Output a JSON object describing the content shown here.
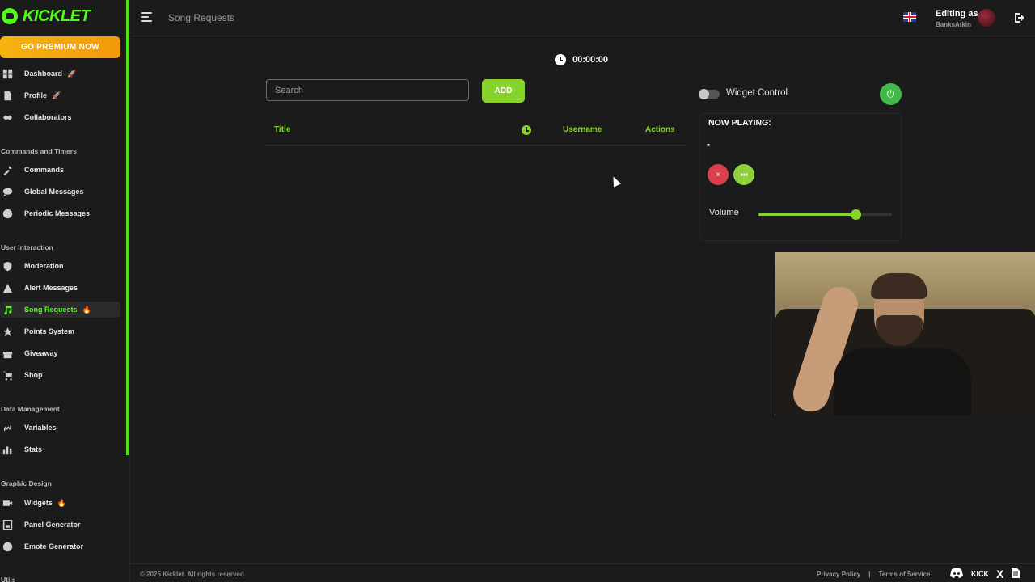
{
  "app": {
    "logo_text": "KICKLET",
    "premium_label": "GO PREMIUM NOW"
  },
  "colors": {
    "accent": "#86d42b",
    "kick_green": "#53fc18",
    "premium": "#f6b40e",
    "stop": "#d9404c",
    "power": "#43b94a"
  },
  "sidebar": {
    "items": [
      {
        "label": "Dashboard",
        "icon": "grid-icon",
        "badge": "🚀"
      },
      {
        "label": "Profile",
        "icon": "document-icon",
        "badge": "🚀"
      },
      {
        "label": "Collaborators",
        "icon": "handshake-icon",
        "badge": ""
      },
      {
        "label": "Commands",
        "icon": "wrench-icon",
        "badge": ""
      },
      {
        "label": "Global Messages",
        "icon": "chat-bubble-icon",
        "badge": ""
      },
      {
        "label": "Periodic Messages",
        "icon": "clock-icon",
        "badge": ""
      },
      {
        "label": "Moderation",
        "icon": "shield-icon",
        "badge": ""
      },
      {
        "label": "Alert Messages",
        "icon": "warning-icon",
        "badge": ""
      },
      {
        "label": "Song Requests",
        "icon": "music-note-icon",
        "badge": "🔥"
      },
      {
        "label": "Points System",
        "icon": "star-icon",
        "badge": ""
      },
      {
        "label": "Giveaway",
        "icon": "gift-icon",
        "badge": ""
      },
      {
        "label": "Shop",
        "icon": "cart-icon",
        "badge": ""
      },
      {
        "label": "Variables",
        "icon": "link-icon",
        "badge": ""
      },
      {
        "label": "Stats",
        "icon": "bar-chart-icon",
        "badge": ""
      },
      {
        "label": "Widgets",
        "icon": "video-icon",
        "badge": "🔥"
      },
      {
        "label": "Panel Generator",
        "icon": "panel-icon",
        "badge": ""
      },
      {
        "label": "Emote Generator",
        "icon": "emoji-icon",
        "badge": ""
      }
    ],
    "sections": [
      "Commands and Timers",
      "User Interaction",
      "Data Management",
      "Graphic Design",
      "Utils"
    ]
  },
  "header": {
    "breadcrumb": "Song Requests",
    "editing_as": "Editing as",
    "username": "BanksAtkin"
  },
  "main": {
    "timer": "00:00:00",
    "search_placeholder": "Search",
    "add_label": "ADD",
    "columns": [
      "Title",
      "Username",
      "Actions"
    ],
    "widget_control_label": "Widget Control",
    "now_playing_title": "NOW PLAYING:",
    "now_playing_value": "-",
    "volume_label": "Volume",
    "volume_level": 0.73,
    "stop_icon": "×",
    "skip_icon": "⏭",
    "power_icon": "⏻"
  },
  "footer": {
    "copyright": "© 2025 Kicklet. All rights reserved.",
    "privacy": "Privacy Policy",
    "separator": "|",
    "terms": "Terms of Service",
    "kick_label": "KICK",
    "x_label": "X"
  }
}
